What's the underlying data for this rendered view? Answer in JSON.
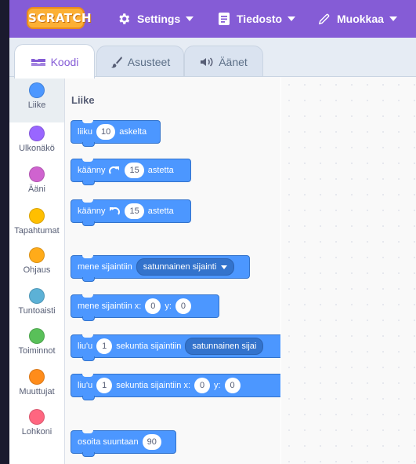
{
  "menubar": {
    "logo_text": "SCRATCH",
    "items": [
      {
        "label": "Settings",
        "icon": "gear-icon"
      },
      {
        "label": "Tiedosto",
        "icon": "file-icon"
      },
      {
        "label": "Muokkaa",
        "icon": "pencil-icon"
      }
    ]
  },
  "tabs": [
    {
      "label": "Koodi",
      "icon": "code-icon",
      "active": true
    },
    {
      "label": "Asusteet",
      "icon": "brush-icon",
      "active": false
    },
    {
      "label": "Äänet",
      "icon": "speaker-icon",
      "active": false
    }
  ],
  "categories": [
    {
      "label": "Liike",
      "color": "#4c97ff"
    },
    {
      "label": "Ulkonäkö",
      "color": "#9966ff"
    },
    {
      "label": "Ääni",
      "color": "#cf63cf"
    },
    {
      "label": "Tapahtumat",
      "color": "#ffbf00"
    },
    {
      "label": "Ohjaus",
      "color": "#ffab19"
    },
    {
      "label": "Tuntoaisti",
      "color": "#5cb1d6"
    },
    {
      "label": "Toiminnot",
      "color": "#59c059"
    },
    {
      "label": "Muuttujat",
      "color": "#ff8c1a"
    },
    {
      "label": "Lohkoni",
      "color": "#ff6680"
    }
  ],
  "palette": {
    "title": "Liike",
    "blocks": {
      "move": {
        "pre": "liiku",
        "value": "10",
        "post": "askelta"
      },
      "turn_right": {
        "pre": "käänny",
        "value": "15",
        "post": "astetta"
      },
      "turn_left": {
        "pre": "käänny",
        "value": "15",
        "post": "astetta"
      },
      "goto": {
        "pre": "mene sijaintiin",
        "dropdown": "satunnainen sijainti"
      },
      "goto_xy": {
        "pre": "mene sijaintiin x:",
        "x": "0",
        "mid": "y:",
        "y": "0"
      },
      "glide": {
        "pre": "liu'u",
        "value": "1",
        "mid": "sekuntia sijaintiin",
        "dropdown": "satunnainen sijai"
      },
      "glide_xy": {
        "pre": "liu'u",
        "value": "1",
        "mid": "sekuntia sijaintiin x:",
        "x": "0",
        "mid2": "y:",
        "y": "0"
      },
      "point": {
        "pre": "osoita suuntaan",
        "value": "90"
      }
    }
  },
  "colors": {
    "motion": "#4c97ff",
    "menubar": "#855cd6"
  }
}
